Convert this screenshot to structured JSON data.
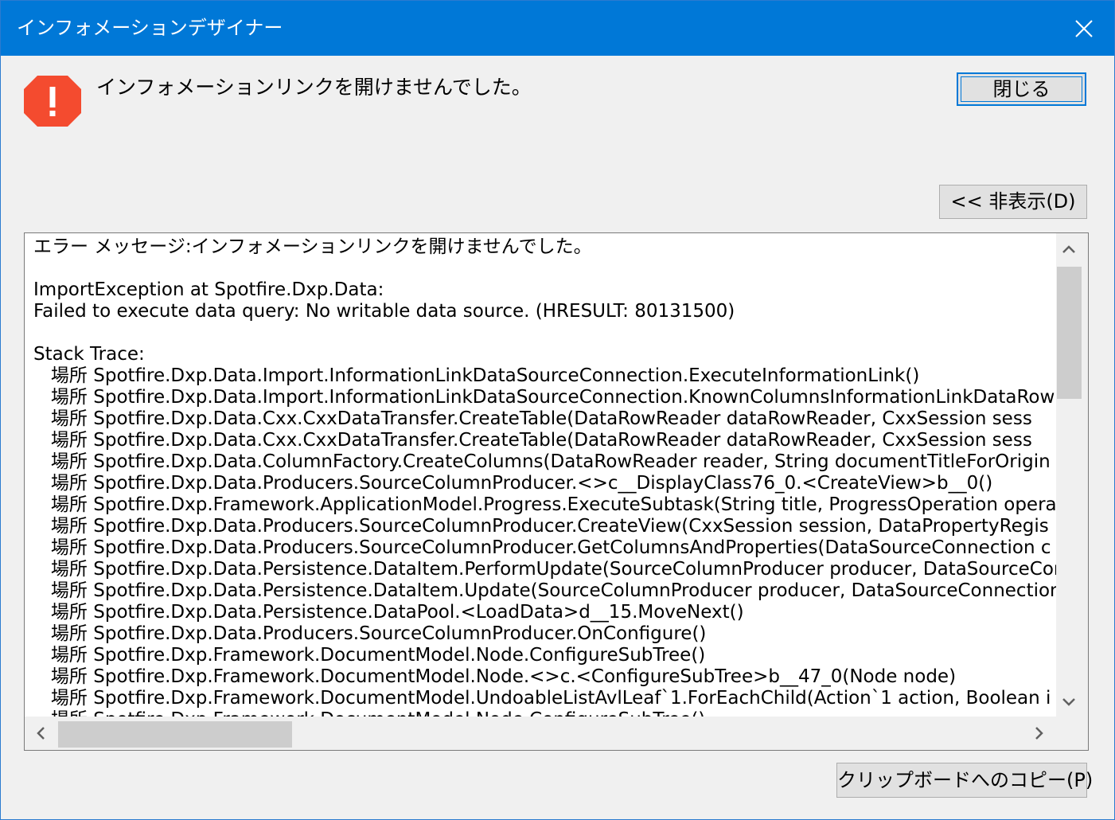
{
  "window": {
    "title": "インフォメーションデザイナー",
    "close_icon": "close-icon"
  },
  "dialog": {
    "icon": "error-icon",
    "icon_color": "#f44b2f",
    "message": "インフォメーションリンクを開けませんでした。",
    "close_button_label": "閉じる",
    "hide_details_label": "<< 非表示(D)",
    "copy_button_label": "クリップボードへのコピー(P)"
  },
  "details": {
    "lines": [
      "エラー メッセージ:インフォメーションリンクを開けませんでした。",
      "",
      "ImportException at Spotfire.Dxp.Data:",
      "Failed to execute data query: No writable data source. (HRESULT: 80131500)",
      "",
      "Stack Trace:",
      "   場所 Spotfire.Dxp.Data.Import.InformationLinkDataSourceConnection.ExecuteInformationLink()",
      "   場所 Spotfire.Dxp.Data.Import.InformationLinkDataSourceConnection.KnownColumnsInformationLinkDataRowR",
      "   場所 Spotfire.Dxp.Data.Cxx.CxxDataTransfer.CreateTable(DataRowReader dataRowReader, CxxSession sess",
      "   場所 Spotfire.Dxp.Data.Cxx.CxxDataTransfer.CreateTable(DataRowReader dataRowReader, CxxSession sess",
      "   場所 Spotfire.Dxp.Data.ColumnFactory.CreateColumns(DataRowReader reader, String documentTitleForOrigin",
      "   場所 Spotfire.Dxp.Data.Producers.SourceColumnProducer.<>c__DisplayClass76_0.<CreateView>b__0()",
      "   場所 Spotfire.Dxp.Framework.ApplicationModel.Progress.ExecuteSubtask(String title, ProgressOperation opera",
      "   場所 Spotfire.Dxp.Data.Producers.SourceColumnProducer.CreateView(CxxSession session, DataPropertyRegis",
      "   場所 Spotfire.Dxp.Data.Producers.SourceColumnProducer.GetColumnsAndProperties(DataSourceConnection c",
      "   場所 Spotfire.Dxp.Data.Persistence.DataItem.PerformUpdate(SourceColumnProducer producer, DataSourceCor",
      "   場所 Spotfire.Dxp.Data.Persistence.DataItem.Update(SourceColumnProducer producer, DataSourceConnection",
      "   場所 Spotfire.Dxp.Data.Persistence.DataPool.<LoadData>d__15.MoveNext()",
      "   場所 Spotfire.Dxp.Data.Producers.SourceColumnProducer.OnConfigure()",
      "   場所 Spotfire.Dxp.Framework.DocumentModel.Node.ConfigureSubTree()",
      "   場所 Spotfire.Dxp.Framework.DocumentModel.Node.<>c.<ConfigureSubTree>b__47_0(Node node)",
      "   場所 Spotfire.Dxp.Framework.DocumentModel.UndoableListAvlLeaf`1.ForEachChild(Action`1 action, Boolean i",
      "   場所 Spotfire.Dxp.Framework.DocumentModel.Node.ConfigureSubTree()"
    ]
  },
  "scrollbars": {
    "up_icon": "chevron-up-icon",
    "down_icon": "chevron-down-icon",
    "left_icon": "chevron-left-icon",
    "right_icon": "chevron-right-icon"
  }
}
